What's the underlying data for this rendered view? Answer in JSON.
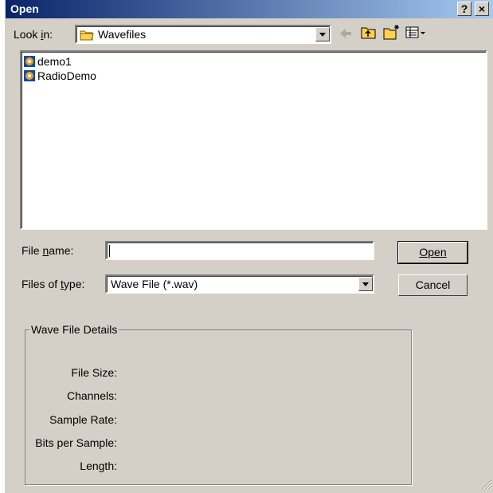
{
  "window": {
    "title": "Open",
    "help_label": "?",
    "close_label": "×"
  },
  "toolbar": {
    "look_in_label": "Look in:",
    "folder": "Wavefiles"
  },
  "files": [
    {
      "name": "demo1",
      "icon": "media-file-icon"
    },
    {
      "name": "RadioDemo",
      "icon": "media-file-icon"
    }
  ],
  "form": {
    "file_name_label": "File name:",
    "file_name_value": "",
    "files_of_type_label": "Files of type:",
    "files_of_type_value": "Wave File (*.wav)",
    "open_button": "Open",
    "cancel_button": "Cancel"
  },
  "details": {
    "title": "Wave File Details",
    "file_size": "File Size:",
    "channels": "Channels:",
    "sample_rate": "Sample Rate:",
    "bits_per_sample": "Bits per Sample:",
    "length": "Length:"
  }
}
